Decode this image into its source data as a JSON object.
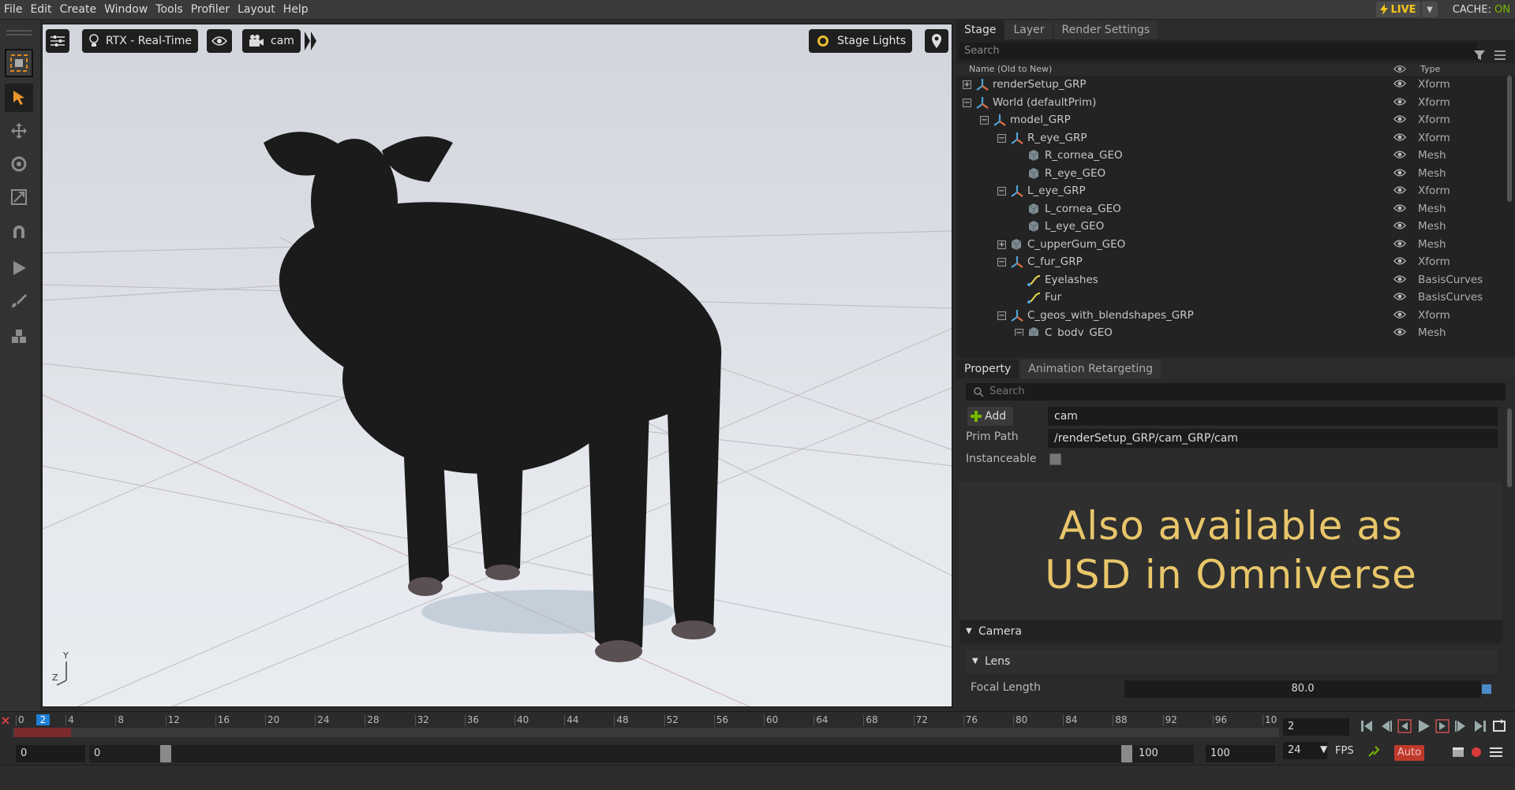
{
  "menu": [
    "File",
    "Edit",
    "Create",
    "Window",
    "Tools",
    "Profiler",
    "Layout",
    "Help"
  ],
  "status": {
    "live_label": "LIVE",
    "cache_label": "CACHE:",
    "cache_state": "ON"
  },
  "viewport": {
    "renderer_label": "RTX - Real-Time",
    "camera_label": "cam",
    "lights_label": "Stage Lights",
    "axis_y": "Y",
    "axis_z": "Z"
  },
  "stage": {
    "tabs": [
      "Stage",
      "Layer",
      "Render Settings"
    ],
    "search_placeholder": "Search",
    "col_name": "Name (Old to New)",
    "col_type": "Type",
    "rows": [
      {
        "name": "renderSetup_GRP",
        "type": "Xform",
        "expander": "+",
        "icon": "xform"
      },
      {
        "name": "World (defaultPrim)",
        "type": "Xform",
        "expander": "-",
        "icon": "xform"
      },
      {
        "name": "model_GRP",
        "type": "Xform",
        "expander": "-",
        "icon": "xform"
      },
      {
        "name": "R_eye_GRP",
        "type": "Xform",
        "expander": "-",
        "icon": "xform"
      },
      {
        "name": "R_cornea_GEO",
        "type": "Mesh",
        "expander": "",
        "icon": "mesh"
      },
      {
        "name": "R_eye_GEO",
        "type": "Mesh",
        "expander": "",
        "icon": "mesh"
      },
      {
        "name": "L_eye_GRP",
        "type": "Xform",
        "expander": "-",
        "icon": "xform"
      },
      {
        "name": "L_cornea_GEO",
        "type": "Mesh",
        "expander": "",
        "icon": "mesh"
      },
      {
        "name": "L_eye_GEO",
        "type": "Mesh",
        "expander": "",
        "icon": "mesh"
      },
      {
        "name": "C_upperGum_GEO",
        "type": "Mesh",
        "expander": "+",
        "icon": "mesh"
      },
      {
        "name": "C_fur_GRP",
        "type": "Xform",
        "expander": "-",
        "icon": "xform"
      },
      {
        "name": "Eyelashes",
        "type": "BasisCurves",
        "expander": "",
        "icon": "curve"
      },
      {
        "name": "Fur",
        "type": "BasisCurves",
        "expander": "",
        "icon": "curve"
      },
      {
        "name": "C_geos_with_blendshapes_GRP",
        "type": "Xform",
        "expander": "-",
        "icon": "xform"
      },
      {
        "name": "C_body_GEO",
        "type": "Mesh",
        "expander": "-",
        "icon": "mesh"
      }
    ]
  },
  "property": {
    "tabs": [
      "Property",
      "Animation Retargeting"
    ],
    "search_placeholder": "Search",
    "add_label": "Add",
    "name_value": "cam",
    "prim_path_label": "Prim Path",
    "prim_path_value": "/renderSetup_GRP/cam_GRP/cam",
    "instanceable_label": "Instanceable",
    "promo_line1": "Also available as",
    "promo_line2": "USD in Omniverse",
    "camera_section": "Camera",
    "lens_section": "Lens",
    "focal_length_label": "Focal Length",
    "focal_length_value": "80.0"
  },
  "timeline": {
    "ticks": [
      "0",
      "2",
      "4",
      "8",
      "12",
      "16",
      "20",
      "24",
      "28",
      "32",
      "36",
      "40",
      "44",
      "48",
      "52",
      "56",
      "60",
      "64",
      "68",
      "72",
      "76",
      "80",
      "84",
      "88",
      "92",
      "96",
      "10"
    ],
    "current_frame": "2",
    "range_start": "0",
    "range_inner_start": "0",
    "range_inner_end": "100",
    "range_end": "100",
    "fps_value": "24",
    "fps_label": "FPS",
    "auto_label": "Auto"
  },
  "colors": {
    "accent": "#76b900",
    "live": "#f5c518",
    "promo": "#e8c66a",
    "current": "#1e7fd6",
    "key": "#c0392b"
  }
}
